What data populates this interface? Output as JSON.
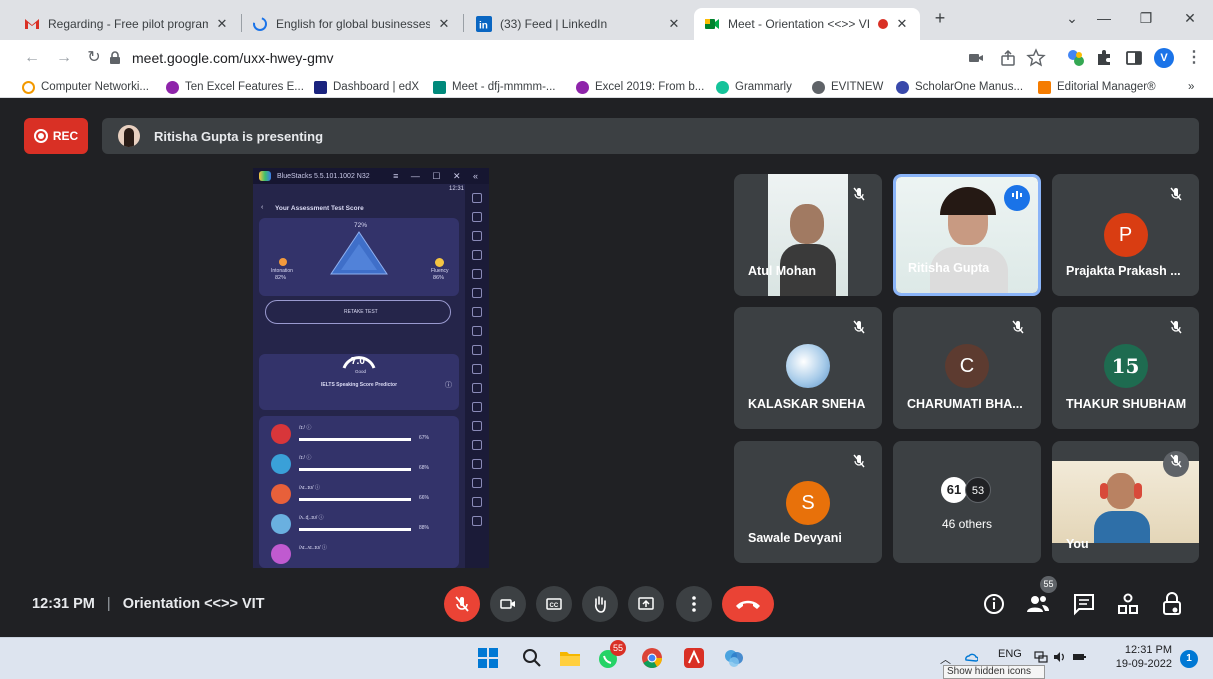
{
  "browser": {
    "tabs": [
      {
        "title": "Regarding - Free pilot program f",
        "icon": "gmail-icon"
      },
      {
        "title": "English for global businesses: Wi",
        "icon": "globe-loading-icon"
      },
      {
        "title": "(33) Feed | LinkedIn",
        "icon": "linkedin-icon"
      },
      {
        "title": "Meet - Orientation <<>> VI",
        "icon": "meet-icon",
        "active": true
      }
    ],
    "new_tab": "+",
    "url": "meet.google.com/uxx-hwey-gmv",
    "profile_initial": "V",
    "bookmarks": [
      {
        "label": "Computer Networki...",
        "color": "#f29900"
      },
      {
        "label": "Ten Excel Features E...",
        "color": "#8e24aa"
      },
      {
        "label": "Dashboard | edX",
        "color": "#1a237e"
      },
      {
        "label": "Meet - dfj-mmmm-...",
        "color": "#00897b"
      },
      {
        "label": "Excel 2019: From b...",
        "color": "#8e24aa"
      },
      {
        "label": "Grammarly",
        "color": "#15c39a"
      },
      {
        "label": "EVITNEW",
        "color": "#5f6368"
      },
      {
        "label": "ScholarOne Manus...",
        "color": "#3949ab"
      },
      {
        "label": "Editorial Manager®",
        "color": "#f57c00"
      }
    ],
    "bookmarks_more": "»"
  },
  "meet": {
    "rec_label": "REC",
    "presenting_text": "Ritisha Gupta is presenting",
    "time": "12:31 PM",
    "separator": "|",
    "meeting_name": "Orientation <<>> VIT",
    "people_count": "55",
    "shared_screen": {
      "window_title": "BlueStacks 5.5.101.1002 N32",
      "clock": "12:31",
      "header": "Your Assessment Test Score",
      "radar_top": "72%",
      "left_metric_label": "Intonation",
      "left_metric_value": "82%",
      "right_metric_label": "Fluency",
      "right_metric_value": "86%",
      "retake_label": "RETAKE TEST",
      "score": "7.0",
      "score_word": "Good",
      "predictor_label": "IELTS Speaking Score Predictor",
      "phonemes": [
        {
          "label": "/ɪ:/ ⓘ",
          "value": "67%",
          "color": "#d8363a"
        },
        {
          "label": "/ɪ:/ ⓘ",
          "value": "68%",
          "color": "#3aa0d8"
        },
        {
          "label": "/ʌɪ..ɪʊ/ ⓘ",
          "value": "66%",
          "color": "#e8603a"
        },
        {
          "label": "/ʌ..ɖ..ɪʊ/ ⓘ",
          "value": "88%",
          "color": "#6ab0e0"
        },
        {
          "label": "/ʌɪ..ʌɪ..ɪʊ/ ⓘ",
          "value": "",
          "color": "#c05ad0"
        }
      ]
    },
    "participants": [
      {
        "name": "Atul Mohan",
        "type": "video",
        "muted": true
      },
      {
        "name": "Ritisha Gupta",
        "type": "video",
        "speaking": true
      },
      {
        "name": "Prajakta Prakash ...",
        "type": "avatar",
        "initial": "P",
        "color": "#d93d12",
        "muted": true
      },
      {
        "name": "KALASKAR SNEHA",
        "type": "avatar-image",
        "muted": true
      },
      {
        "name": "CHARUMATI BHA...",
        "type": "avatar",
        "initial": "C",
        "color": "#5d3b30",
        "muted": true
      },
      {
        "name": "THAKUR SHUBHAM",
        "type": "avatar",
        "initial": "15",
        "color": "#1e6b50",
        "muted": true
      },
      {
        "name": "Sawale Devyani",
        "type": "avatar",
        "initial": "S",
        "color": "#e8710a",
        "muted": true
      },
      {
        "name": "46 others",
        "type": "others",
        "badge1": "61",
        "badge2": "53"
      },
      {
        "name": "You",
        "type": "video",
        "muted": true
      }
    ]
  },
  "taskbar": {
    "apps": [
      "windows-start",
      "search",
      "file-explorer",
      "whatsapp",
      "chrome",
      "acrobat",
      "photos"
    ],
    "whatsapp_badge": "55",
    "lang": "ENG",
    "time": "12:31 PM",
    "date": "19-09-2022",
    "notification_count": "1",
    "tooltip": "Show hidden icons"
  }
}
